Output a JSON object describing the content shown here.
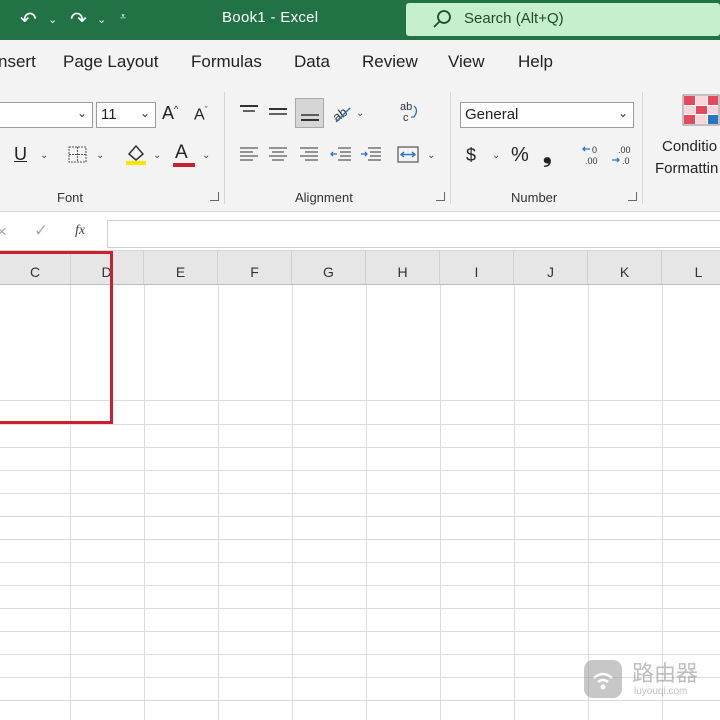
{
  "titlebar": {
    "title": "Book1  -  Excel",
    "search_placeholder": "Search (Alt+Q)"
  },
  "menu": [
    "nsert",
    "Page Layout",
    "Formulas",
    "Data",
    "Review",
    "View",
    "Help"
  ],
  "ribbon": {
    "font": {
      "size": "11",
      "grow_label": "A",
      "shrink_label": "A",
      "underline_label": "U",
      "font_color_label": "A",
      "group_label": "Font"
    },
    "alignment": {
      "group_label": "Alignment"
    },
    "number": {
      "format": "General",
      "currency": "$",
      "percent": "%",
      "comma": "❟",
      "group_label": "Number"
    },
    "styles": {
      "conditional_line1": "Conditio",
      "conditional_line2": "Formattin"
    }
  },
  "formula_bar": {
    "fx_label": "fx",
    "value": ""
  },
  "columns": [
    "C",
    "D",
    "E",
    "F",
    "G",
    "H",
    "I",
    "J",
    "K",
    "L"
  ],
  "watermark": {
    "cn": "路由器",
    "en": "luyouqi.com"
  },
  "colors": {
    "accent": "#217346",
    "search_bg": "#c6efce",
    "highlight": "#c8202f"
  }
}
